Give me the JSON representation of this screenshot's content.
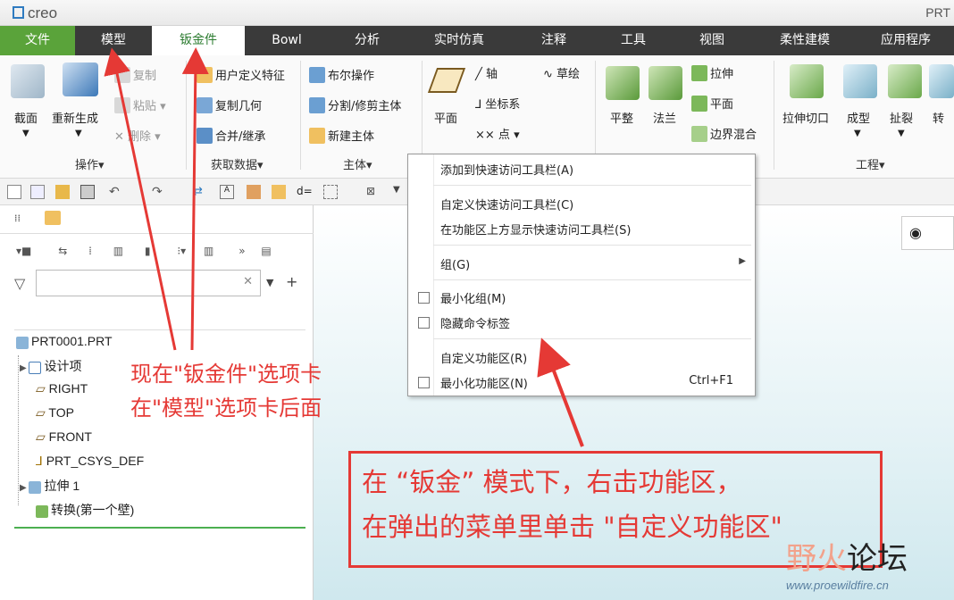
{
  "titlebar": {
    "app": "creo",
    "title": "PRT"
  },
  "tabs": [
    "文件",
    "模型",
    "钣金件",
    "Bowl",
    "分析",
    "实时仿真",
    "注释",
    "工具",
    "视图",
    "柔性建模",
    "应用程序"
  ],
  "ribbon": {
    "section": "截面",
    "regenerate": "重新生成",
    "copy": "复制",
    "paste": "粘贴",
    "delete": "删除",
    "ops_group": "操作",
    "user_feature": "用户定义特征",
    "copy_geom": "复制几何",
    "merge": "合并/继承",
    "get_data_group": "获取数据",
    "boolean": "布尔操作",
    "split": "分割/修剪主体",
    "new_body": "新建主体",
    "body_group": "主体",
    "plane": "平面",
    "axis": "轴",
    "csys": "坐标系",
    "point": "点",
    "sketch": "草绘",
    "flat": "平整",
    "flange": "法兰",
    "extrude": "拉伸",
    "plane2": "平面",
    "blend": "边界混合",
    "extrude_cut": "拉伸切口",
    "form": "成型",
    "rip": "扯裂",
    "convert": "转",
    "eng_group": "工程"
  },
  "tree": {
    "root": "PRT0001.PRT",
    "items": [
      "设计项",
      "RIGHT",
      "TOP",
      "FRONT",
      "PRT_CSYS_DEF",
      "拉伸 1",
      "转换(第一个壁)"
    ]
  },
  "menu": {
    "items": [
      "添加到快速访问工具栏(A)",
      "自定义快速访问工具栏(C)",
      "在功能区上方显示快速访问工具栏(S)",
      "组(G)",
      "最小化组(M)",
      "隐藏命令标签",
      "自定义功能区(R)",
      "最小化功能区(N)"
    ],
    "shortcut": "Ctrl+F1"
  },
  "annotations": {
    "note1_line1": "现在\"钣金件\"选项卡",
    "note1_line2": "在\"模型\"选项卡后面",
    "note2_line1": "在 “钣金” 模式下，右击功能区，",
    "note2_line2": "在弹出的菜单里单击 \"自定义功能区\""
  },
  "watermark": {
    "cn_a": "野火",
    "cn_b": "论坛",
    "url": "www.proewildfire.cn"
  },
  "colors": {
    "accent": "#e53935",
    "file_tab": "#5aa33a",
    "active_tab_text": "#2e7d32"
  }
}
